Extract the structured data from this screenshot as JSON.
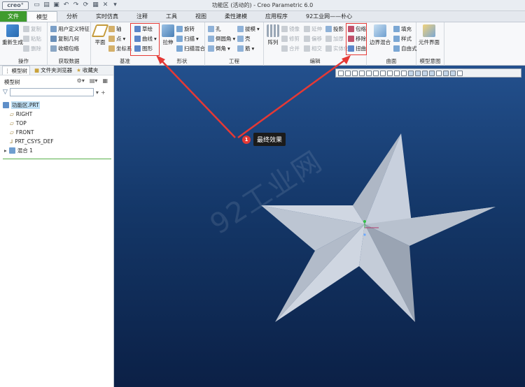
{
  "titlebar": {
    "logo": "creo°",
    "title": "功能区 (活动的) - Creo Parametric 6.0"
  },
  "menu_tabs": [
    "文件",
    "模型",
    "分析",
    "实时仿真",
    "注释",
    "工具",
    "视图",
    "柔性建模",
    "应用程序",
    "92工业网——朴心"
  ],
  "ribbon": {
    "operations": {
      "regenerate": "重新生成",
      "copy": "复制",
      "paste": "粘贴",
      "delete": "删除",
      "label": "操作"
    },
    "get_data": {
      "udf": "用户定义特征",
      "copy_geom": "复制几何",
      "shrinkwrap": "收缩包络",
      "label": "获取数据"
    },
    "datum": {
      "plane": "平面",
      "axis": "轴",
      "point": "点",
      "csys": "坐标系",
      "sketch": "草绘",
      "curve": "曲线",
      "graph": "图形",
      "label": "基准"
    },
    "shapes": {
      "extrude": "拉伸",
      "revolve": "旋转",
      "sweep": "扫描",
      "swept_blend": "扫描混合",
      "label": "形状"
    },
    "engineering": {
      "hole": "孔",
      "round": "倒圆角",
      "chamfer": "倒角",
      "draft": "拔模",
      "shell": "壳",
      "rib": "筋",
      "label": "工程"
    },
    "editing": {
      "pattern": "阵列",
      "mirror": "镜像",
      "trim": "修剪",
      "merge": "合并",
      "extend": "延伸",
      "offset": "偏移",
      "intersect": "相交",
      "project": "投影",
      "thicken": "加厚",
      "solidify": "实体化",
      "wrap": "包络",
      "remove": "移除",
      "toroidal_bend": "扭曲",
      "label": "编辑"
    },
    "surfaces": {
      "boundary_blend": "边界混合",
      "fill": "填充",
      "style": "样式",
      "freestyle": "自由式",
      "label": "曲面"
    },
    "model_intent": {
      "component_interface": "元件界面",
      "label": "模型意图"
    }
  },
  "panel": {
    "tabs": [
      "模型树",
      "文件夹浏览器",
      "收藏夹"
    ],
    "title": "模型树",
    "filter_placeholder": "",
    "tree": [
      "功能区.PRT",
      "RIGHT",
      "TOP",
      "FRONT",
      "PRT_CSYS_DEF",
      "混合 1"
    ]
  },
  "viewport": {
    "callout_number": "1",
    "callout_text": "最终效果",
    "watermark": "92工业网"
  },
  "colors": {
    "file_tab": "#3f9b2e",
    "highlight": "#e53935",
    "viewport_top": "#23508d",
    "viewport_bottom": "#0b2046",
    "star_face": "#c4ccd8"
  }
}
